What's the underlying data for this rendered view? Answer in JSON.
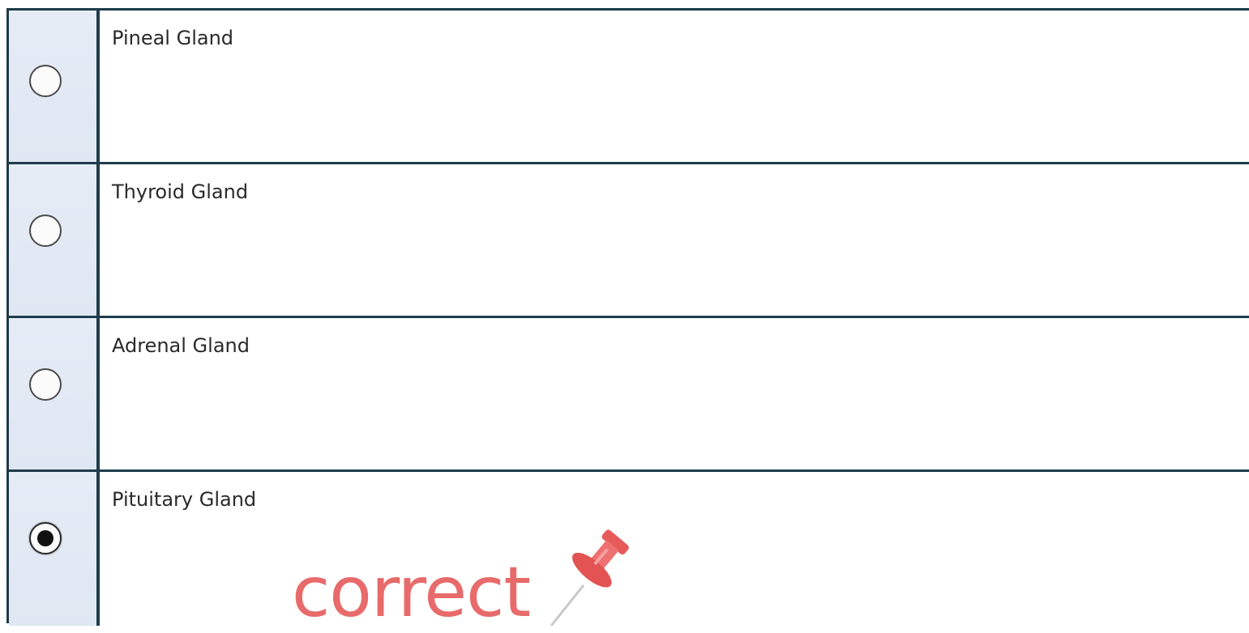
{
  "options": [
    {
      "label": "Pineal Gland",
      "selected": false
    },
    {
      "label": "Thyroid Gland",
      "selected": false
    },
    {
      "label": "Adrenal Gland",
      "selected": false
    },
    {
      "label": "Pituitary Gland",
      "selected": true
    }
  ],
  "feedback": {
    "text": "correct",
    "icon": "pushpin-icon",
    "color": "#e86a6a"
  },
  "colors": {
    "border": "#1f3c4a",
    "radio_column": "#e2e9f4"
  }
}
